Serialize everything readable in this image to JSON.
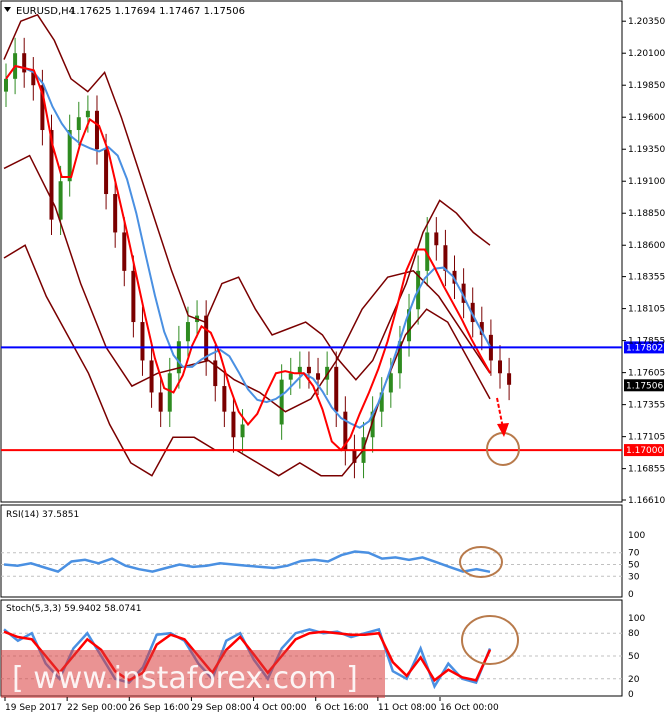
{
  "header": {
    "symbol": "EURUSD,H4",
    "ohlc": "1.17625 1.17694 1.17467 1.17506"
  },
  "watermark": "[ www.instaforex.com ]",
  "colors": {
    "bull_candle": "#2e8b20",
    "bear_candle": "#7a0000",
    "bollinger": "#7a0000",
    "ma_fast": "#ff0000",
    "ma_slow": "#4a90e2",
    "resistance": "#0000ff",
    "support": "#ff0000",
    "annotation_circle": "#b87a4b",
    "arrow": "#ff0000",
    "watermark_bg": "#d93a3a"
  },
  "chart_data": [
    {
      "type": "candlestick",
      "title": "EURUSD,H4",
      "ylim": [
        1.1661,
        1.205
      ],
      "y_ticks": [
        "1.20350",
        "1.20100",
        "1.19850",
        "1.19600",
        "1.19350",
        "1.19100",
        "1.18850",
        "1.18600",
        "1.18355",
        "1.18105",
        "1.17855",
        "1.17605",
        "1.17355",
        "1.17105",
        "1.16855",
        "1.16610"
      ],
      "x_ticks": [
        "19 Sep 2017",
        "22 Sep 00:00",
        "26 Sep 16:00",
        "29 Sep 08:00",
        "4 Oct 00:00",
        "6 Oct 16:00",
        "11 Oct 08:00",
        "16 Oct 00:00"
      ],
      "close": [
        1.199,
        1.201,
        1.1995,
        1.1985,
        1.195,
        1.188,
        1.191,
        1.195,
        1.196,
        1.1965,
        1.1935,
        1.19,
        1.187,
        1.184,
        1.18,
        1.177,
        1.1745,
        1.173,
        1.176,
        1.1785,
        1.18,
        1.1805,
        1.177,
        1.175,
        1.173,
        1.171,
        1.172,
        1.1755,
        1.176,
        1.1765,
        1.176,
        1.1755,
        1.1765,
        1.173,
        1.17,
        1.169,
        1.171,
        1.173,
        1.1745,
        1.176,
        1.1785,
        1.181,
        1.184,
        1.187,
        1.186,
        1.184,
        1.183,
        1.1815,
        1.18,
        1.179,
        1.177,
        1.176,
        1.1751
      ],
      "bands": {
        "upper": [
          1.2005,
          1.2035,
          1.204,
          1.202,
          1.199,
          1.198,
          1.1995,
          1.196,
          1.192,
          1.188,
          1.184,
          1.1805,
          1.18,
          1.183,
          1.1835,
          1.181,
          1.179,
          1.1795,
          1.18,
          1.179,
          1.177,
          1.1755,
          1.177,
          1.18,
          1.183,
          1.187,
          1.1895,
          1.1885,
          1.187,
          1.186
        ],
        "middle": [
          1.192,
          1.193,
          1.189,
          1.183,
          1.178,
          1.175,
          1.176,
          1.1765,
          1.177,
          1.1755,
          1.1745,
          1.173,
          1.174,
          1.177,
          1.181,
          1.1835,
          1.184,
          1.182,
          1.179,
          1.176
        ],
        "lower": [
          1.185,
          1.186,
          1.182,
          1.179,
          1.176,
          1.172,
          1.169,
          1.168,
          1.171,
          1.171,
          1.17,
          1.17,
          1.169,
          1.168,
          1.169,
          1.168,
          1.168,
          1.17,
          1.175,
          1.179,
          1.181,
          1.18,
          1.177,
          1.174
        ]
      },
      "levels": [
        {
          "value": 1.17802,
          "label": "1.17802",
          "color": "#0000ff"
        },
        {
          "value": 1.17,
          "label": "1.17000",
          "color": "#ff0000"
        }
      ],
      "last_price_label": "1.17506"
    },
    {
      "type": "line",
      "title": "RSI(14) 37.5851",
      "ylim": [
        0,
        100
      ],
      "y_ticks": [
        "100",
        "70",
        "50",
        "30",
        "0"
      ],
      "series": [
        {
          "values": [
            50,
            48,
            52,
            45,
            38,
            55,
            58,
            52,
            60,
            48,
            42,
            38,
            44,
            50,
            46,
            48,
            52,
            50,
            48,
            46,
            44,
            48,
            56,
            58,
            55,
            66,
            72,
            70,
            60,
            62,
            58,
            62,
            54,
            46,
            38,
            42,
            37.6
          ]
        }
      ]
    },
    {
      "type": "line",
      "title": "Stoch(5,3,3) 59.9402 58.0741",
      "ylim": [
        0,
        100
      ],
      "y_ticks": [
        "100",
        "80",
        "50",
        "20",
        "0"
      ],
      "series": [
        {
          "values": [
            85,
            70,
            80,
            40,
            20,
            60,
            80,
            50,
            20,
            15,
            35,
            78,
            80,
            70,
            40,
            20,
            70,
            80,
            45,
            20,
            60,
            80,
            85,
            80,
            82,
            75,
            80,
            85,
            30,
            20,
            60,
            10,
            40,
            20,
            15,
            59.9
          ]
        },
        {
          "values": [
            82,
            75,
            72,
            50,
            28,
            50,
            72,
            58,
            30,
            18,
            28,
            65,
            78,
            72,
            50,
            28,
            58,
            75,
            52,
            28,
            50,
            72,
            80,
            82,
            80,
            78,
            78,
            80,
            42,
            24,
            48,
            18,
            32,
            22,
            18,
            58.1
          ]
        }
      ]
    }
  ]
}
